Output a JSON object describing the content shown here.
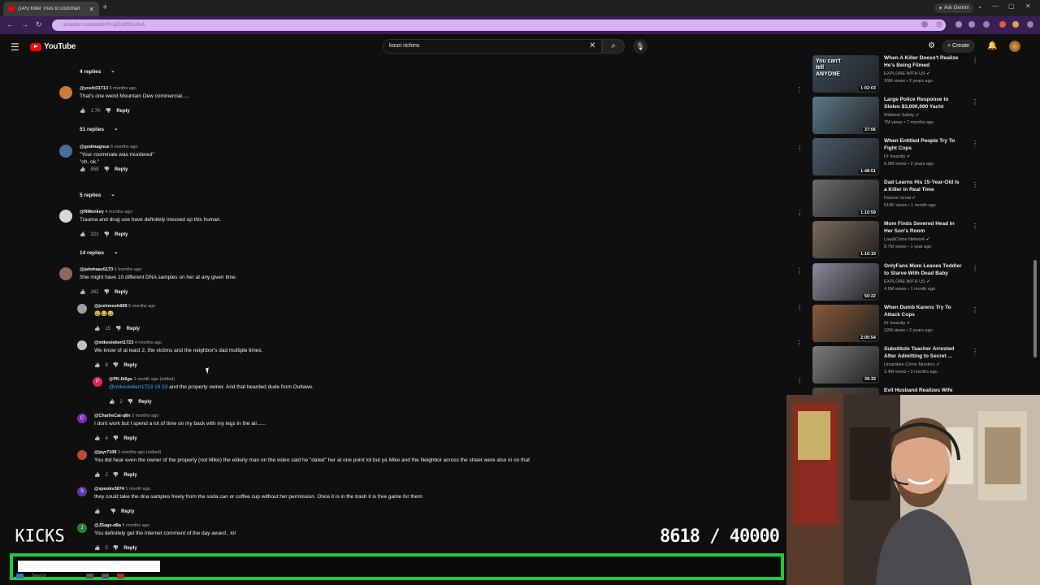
{
  "browser": {
    "tab_title": "(145) Killer Tries to Outsmart",
    "url": "youtube.com/watch?v=gZLWM2LHvA",
    "gemini_label": "Ask Gemini"
  },
  "youtube": {
    "logo_text": "YouTube",
    "search_query": "kouri richins",
    "create_label": "Create"
  },
  "comments": [
    {
      "type": "replies",
      "label": "4 replies"
    },
    {
      "type": "comment",
      "handle": "@yoshi31713",
      "time": "6 months ago",
      "text": "That's one weird Mountain Dew commercial.....",
      "likes": "1.7K",
      "reply": "Reply"
    },
    {
      "type": "replies",
      "label": "51 replies"
    },
    {
      "type": "comment",
      "handle": "@godmagnus",
      "time": "6 months ago",
      "text": "\"Your roommate was murdered\"",
      "text2": "\"oh, ok.\"",
      "likes": "858",
      "reply": "Reply"
    },
    {
      "type": "replies",
      "label": "5 replies"
    },
    {
      "type": "comment",
      "handle": "@RMonkey",
      "time": "4 months ago",
      "text": "Trauma and drug use have definitely messed up this human.",
      "likes": "323",
      "reply": "Reply"
    },
    {
      "type": "replies",
      "label": "14 replies"
    },
    {
      "type": "comment",
      "handle": "@jalmhaas5170",
      "time": "6 months ago",
      "text": "She might have 10 different DNA samples on her at any given time.",
      "likes": "262",
      "reply": "Reply"
    },
    {
      "type": "reply",
      "handle": "@joshmosh689",
      "time": "6 months ago",
      "text": "😂😂😂",
      "likes": "15",
      "reply": "Reply"
    },
    {
      "type": "reply",
      "handle": "@mikesiebert1723",
      "time": "4 months ago",
      "text": "We know of at least 2, the victims and the neighbor's dad multiple times.",
      "likes": "8",
      "reply": "Reply"
    },
    {
      "type": "reply2",
      "handle": "@PK-lk5gs",
      "time": "1 month ago (edited)",
      "mention": "@mikesiebert1723 16:33",
      "text": " and the property owner. And that bearded dude from Outlaws.",
      "likes": "2",
      "reply": "Reply"
    },
    {
      "type": "reply",
      "handle": "@CharlieCat-q8n",
      "time": "2 months ago",
      "text": "I dont work but I spend a lot of time on my back with my legs in the air......",
      "likes": "4",
      "reply": "Reply"
    },
    {
      "type": "reply",
      "handle": "@jayr7108",
      "time": "3 months ago (edited)",
      "text": "You did hear even the owner of the property (not Mike) the elderly man on the video said he \"dated\" her at one point lol but ya Mike and the Neighbor across the street were also in on that",
      "likes": "2",
      "reply": "Reply"
    },
    {
      "type": "reply",
      "handle": "@spookv3874",
      "time": "1 month ago",
      "text": "they could take the dna samples freely from the soda can or coffee cup without her permission. Once it is in the trash it is free game for them",
      "likes": "",
      "reply": "Reply"
    },
    {
      "type": "reply",
      "handle": "@JSage-d8a",
      "time": "5 months ago",
      "text": "You definitely get the internet comment of the day award , lol",
      "likes": "5",
      "reply": "Reply"
    }
  ],
  "sidebar_videos": [
    {
      "title": "When A Killer Doesn't Realize He's Being Filmed",
      "channel": "EXPLORE WITH US",
      "stats": "16M views • 2 years ago",
      "duration": "1:02:03",
      "thumb_overlay": "You can't tell ANYONE"
    },
    {
      "title": "Large Police Response to Stolen $3,000,000 Yacht",
      "channel": "Midwest Safety",
      "stats": "7M views • 7 months ago",
      "duration": "37:06"
    },
    {
      "title": "When Entitled People Try To Fight Cops",
      "channel": "Dr Insanity",
      "stats": "6.9M views • 2 years ago",
      "duration": "1:48:51"
    },
    {
      "title": "Dad Learns His 15-Year-Old Is a Killer in Real Time",
      "channel": "Damon Verial",
      "stats": "619K views • 1 month ago",
      "duration": "1:10:59"
    },
    {
      "title": "Mom Finds Severed Head In Her Son's Room",
      "channel": "Law&Crime Network",
      "stats": "8.7M views • 1 year ago",
      "duration": "1:10:19"
    },
    {
      "title": "OnlyFans Mom Leaves Toddler to Starve With Dead Baby",
      "channel": "EXPLORE WITH US",
      "stats": "4.6M views • 1 month ago",
      "duration": "50:22"
    },
    {
      "title": "When Dumb Karens Try To Attack Cops",
      "channel": "Dr Insanity",
      "stats": "32M views • 2 years ago",
      "duration": "2:00:54"
    },
    {
      "title": "Substitute Teacher Arrested After Admitting to Secret ...",
      "channel": "Unspoken Crime Murders",
      "stats": "3.4M views • 3 months ago",
      "duration": "39:33"
    },
    {
      "title": "Evil Husband Realizes Wife",
      "channel": "",
      "stats": "",
      "duration": ""
    }
  ],
  "overlay": {
    "kicks_label": "KICKS",
    "counter": "8618 / 40000",
    "progress_current": 8618,
    "progress_goal": 40000,
    "accent_color": "#22c93a"
  },
  "taskbar": {
    "search_label": "Search"
  },
  "colors": {
    "background": "#0f0f0f",
    "link": "#3ea6ff",
    "address_bar": "#3a1f55"
  }
}
